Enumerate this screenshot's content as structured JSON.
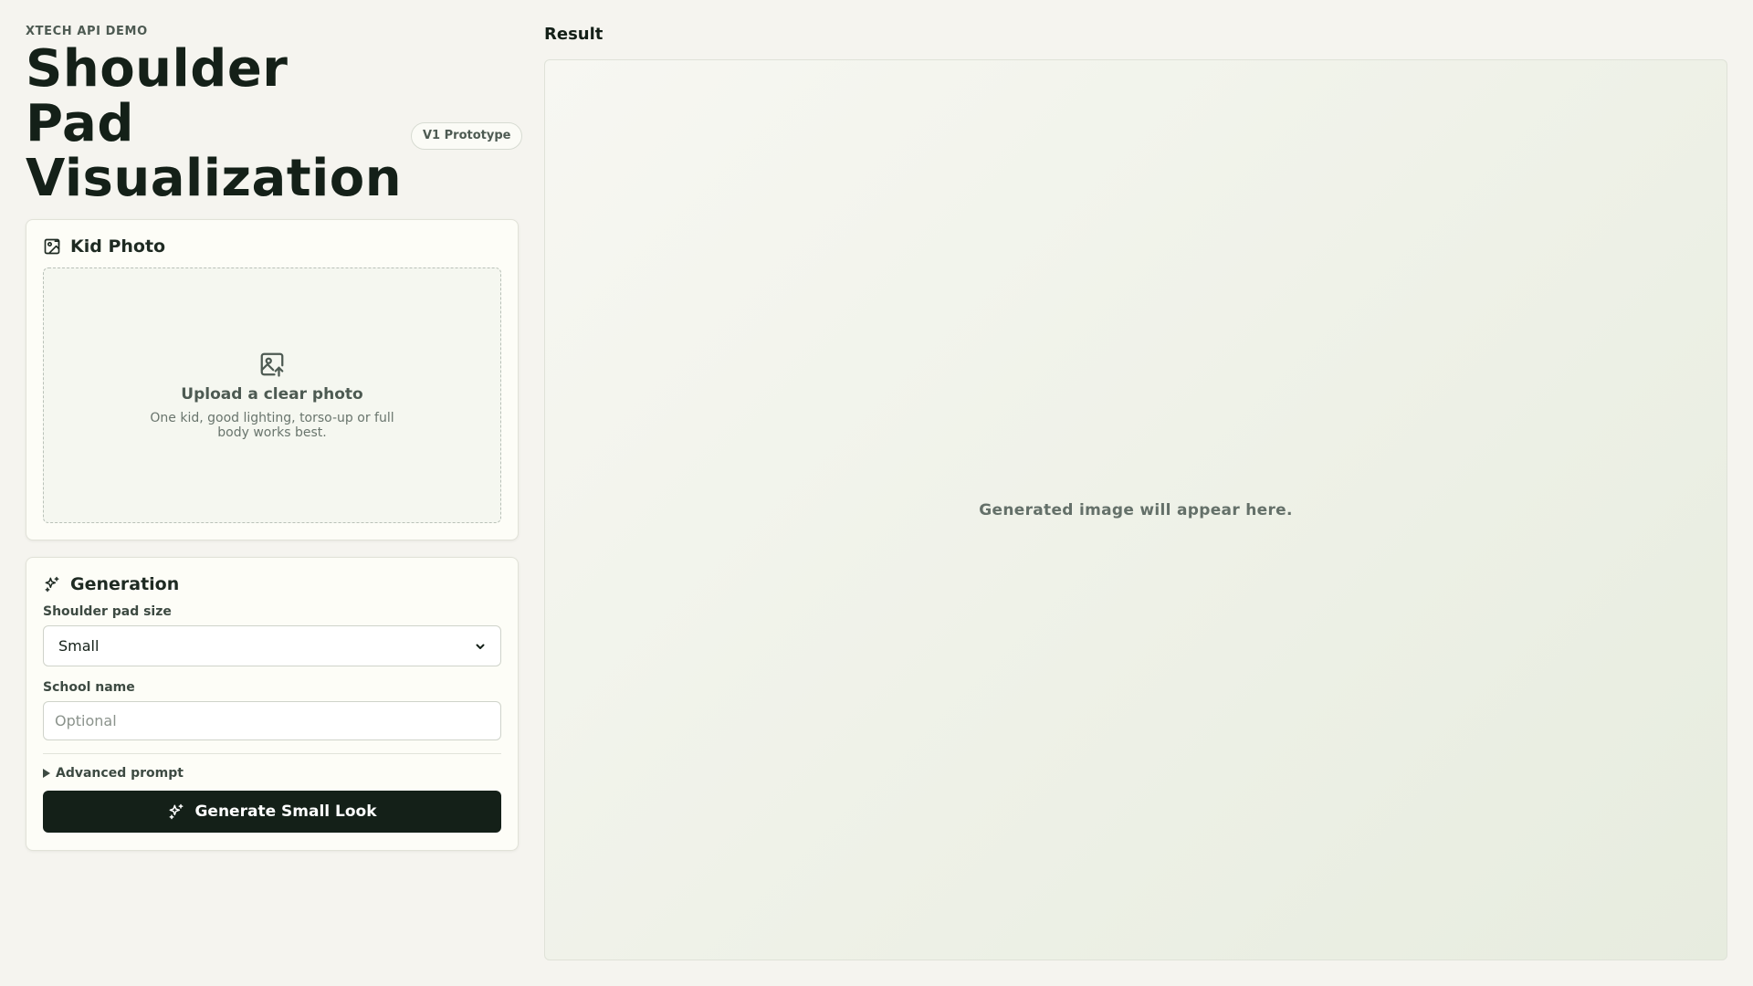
{
  "header": {
    "eyebrow": "XTECH API DEMO",
    "title": "Shoulder Pad Visualization",
    "badge": "V1 Prototype"
  },
  "photo_card": {
    "title": "Kid Photo",
    "icon": "image-icon",
    "dropzone": {
      "icon": "image-upload-icon",
      "title": "Upload a clear photo",
      "subtitle": "One kid, good lighting, torso-up or full body works best."
    }
  },
  "generation_card": {
    "title": "Generation",
    "icon": "sparkles-icon",
    "size_label": "Shoulder pad size",
    "size_value": "Small",
    "school_label": "School name",
    "school_placeholder": "Optional",
    "school_value": "",
    "advanced_label": "Advanced prompt",
    "button_label": "Generate Small Look",
    "button_icon": "sparkles-icon"
  },
  "result": {
    "heading": "Result",
    "placeholder": "Generated image will appear here."
  },
  "colors": {
    "background": "#f5f4ef",
    "primary_button": "#142018",
    "text_dark": "#142018",
    "muted": "#4d5a52"
  }
}
